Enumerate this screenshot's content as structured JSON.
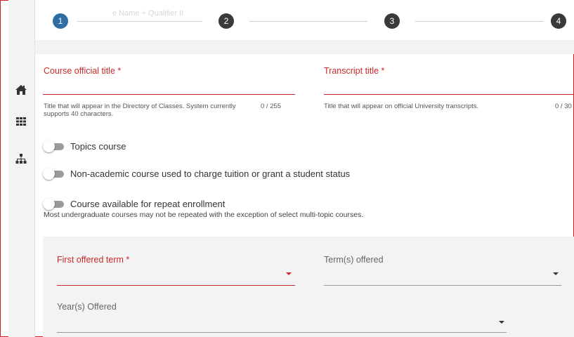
{
  "stepper": {
    "steps": [
      "1",
      "2",
      "3",
      "4"
    ],
    "active_index": 0,
    "ghost_text": "e Name + Qualifier II"
  },
  "sidebar": {
    "icons": [
      "home-icon",
      "grid-icon",
      "sitemap-icon"
    ]
  },
  "form": {
    "course_title": {
      "label": "Course official title *",
      "hint": "Title that will appear in the Directory of Classes. System currently supports 40 characters.",
      "counter": "0 / 255",
      "value": ""
    },
    "transcript_title": {
      "label": "Transcript title *",
      "hint": "Title that will appear on official University transcripts.",
      "counter": "0 / 30",
      "value": ""
    },
    "toggles": [
      {
        "label": "Topics course",
        "on": false
      },
      {
        "label": "Non-academic course used to charge tuition or grant a student status",
        "on": false
      },
      {
        "label": "Course available for repeat enrollment",
        "on": false
      }
    ],
    "repeat_note": "Most undergraduate courses may not be repeated with the exception of select multi-topic courses.",
    "first_offered_term": {
      "label": "First offered term *",
      "value": ""
    },
    "terms_offered": {
      "label": "Term(s) offered",
      "value": ""
    },
    "years_offered": {
      "label": "Year(s) Offered",
      "value": ""
    }
  },
  "colors": {
    "accent": "#2f6ea5",
    "required": "#c82a2a",
    "frame": "#d11f1f"
  }
}
